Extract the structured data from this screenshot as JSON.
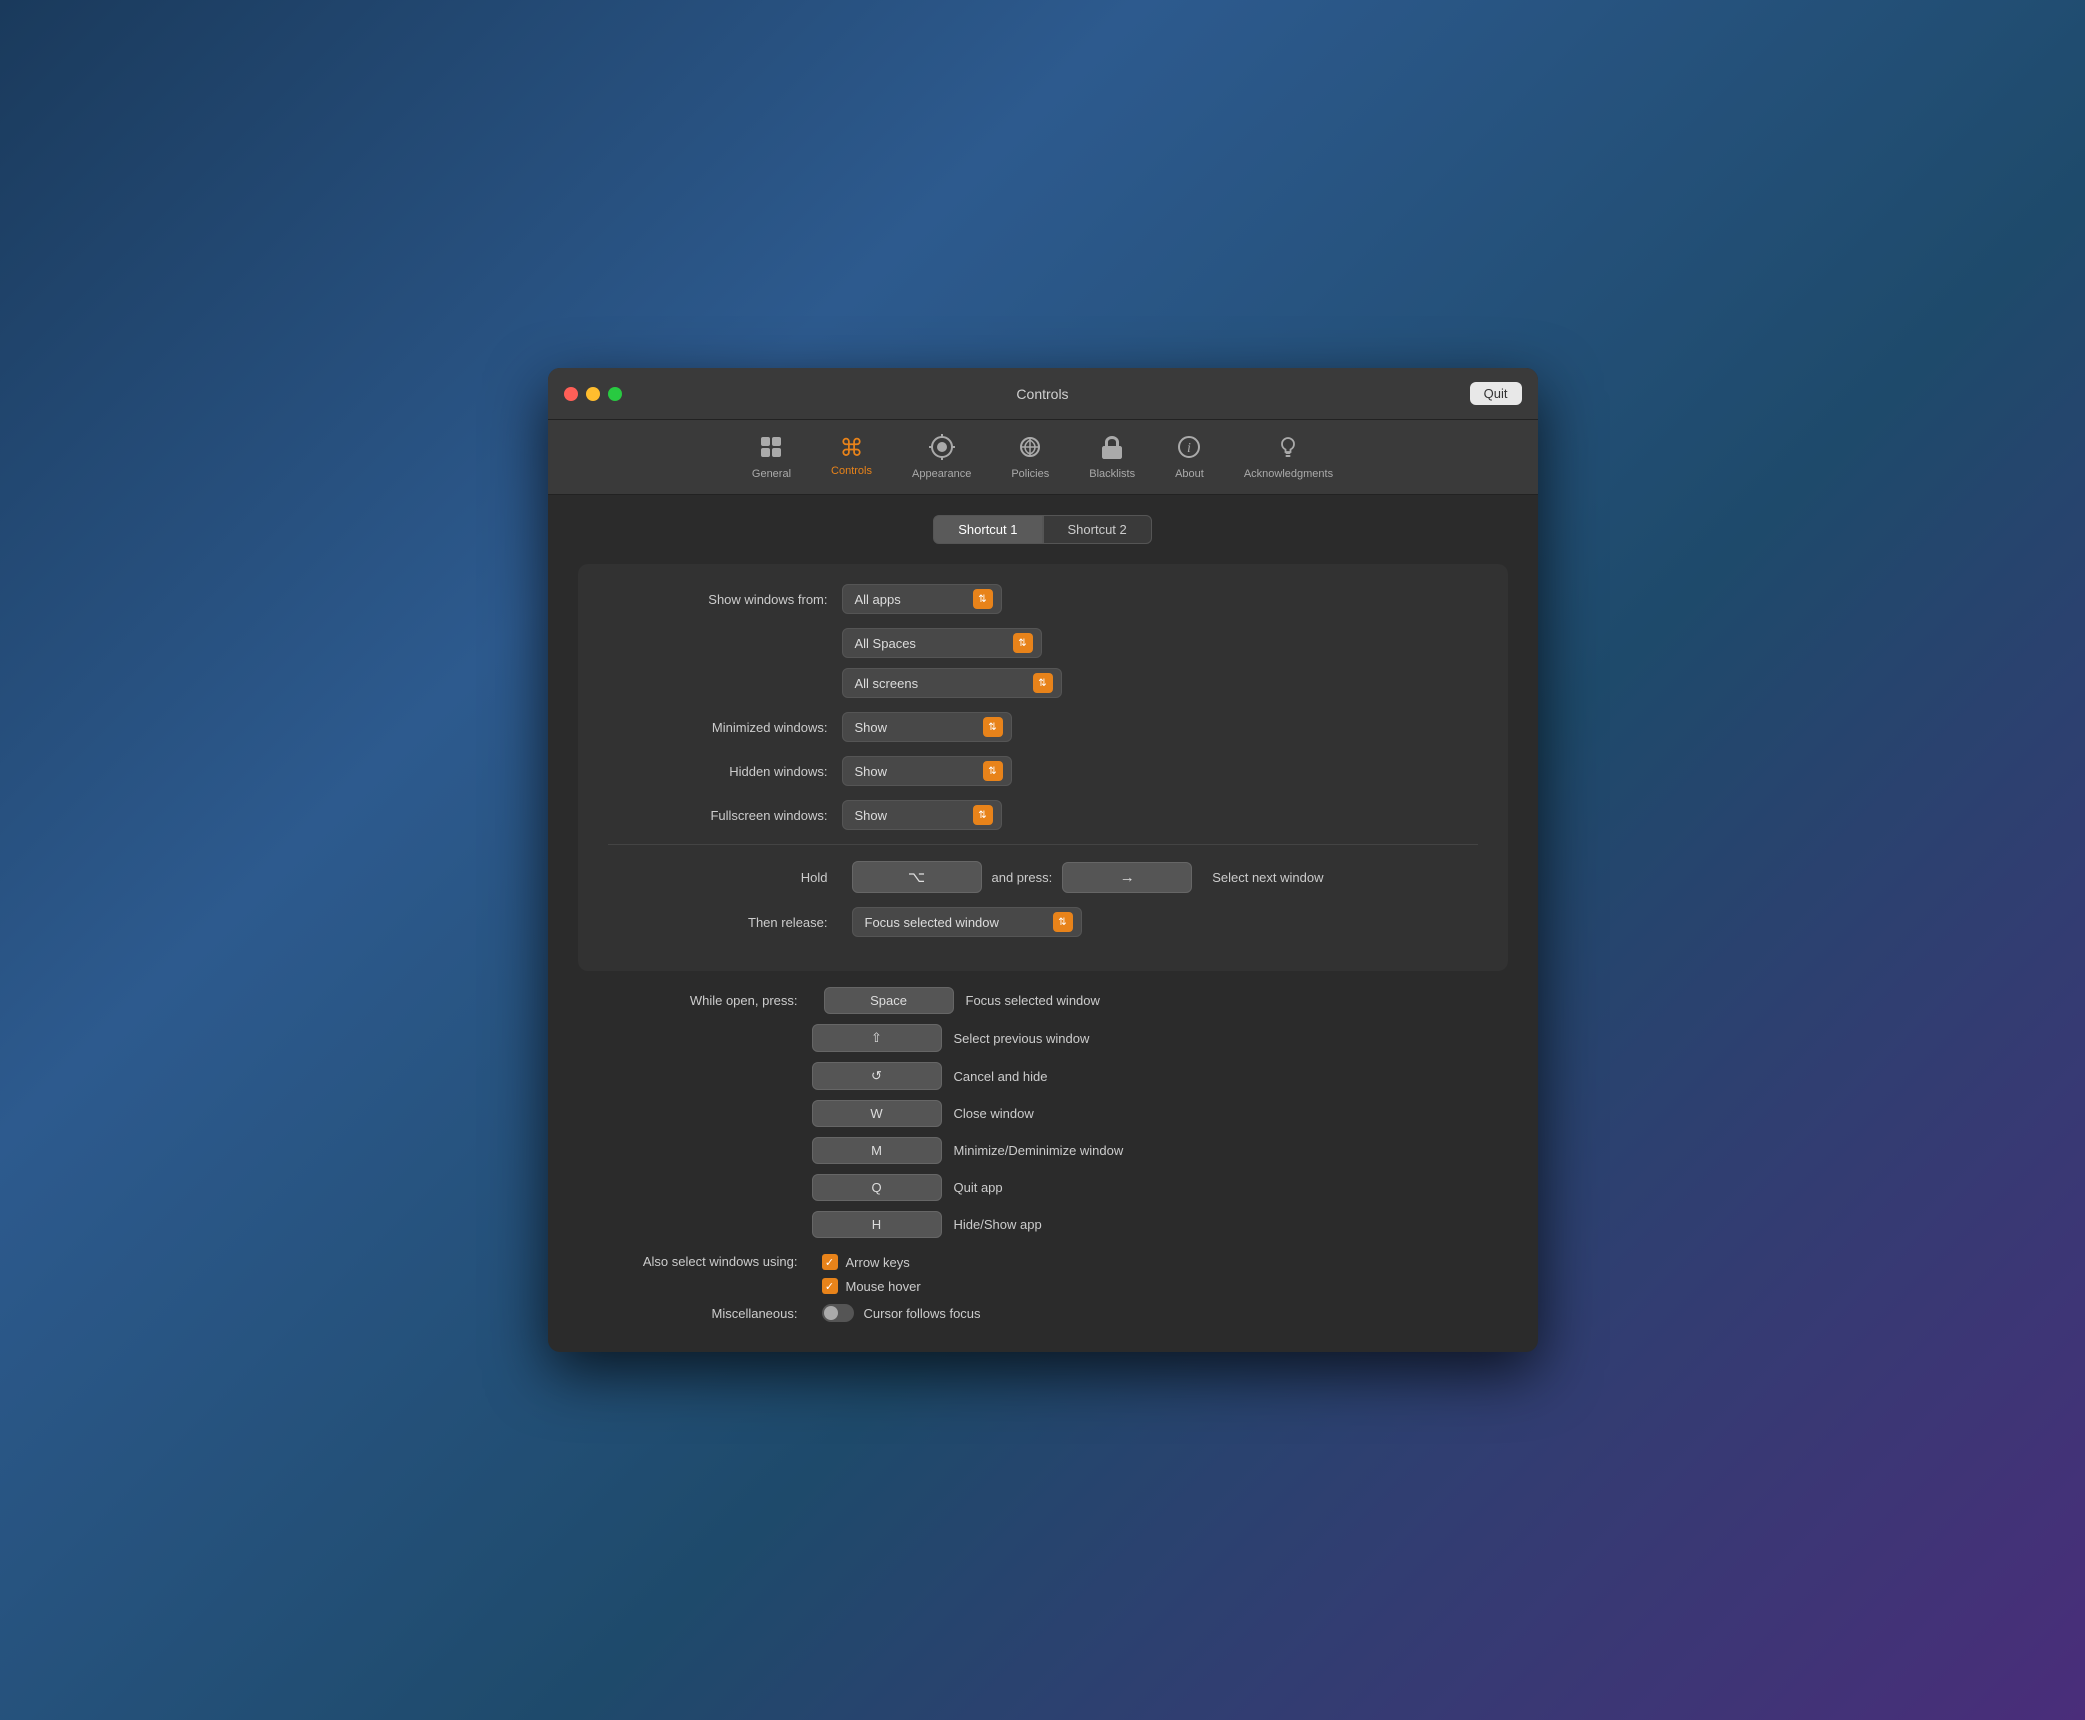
{
  "window": {
    "title": "Controls",
    "quit_label": "Quit"
  },
  "toolbar": {
    "items": [
      {
        "id": "general",
        "label": "General",
        "icon": "⊟",
        "active": false
      },
      {
        "id": "controls",
        "label": "Controls",
        "icon": "⌘",
        "active": true
      },
      {
        "id": "appearance",
        "label": "Appearance",
        "icon": "🎨",
        "active": false
      },
      {
        "id": "policies",
        "label": "Policies",
        "icon": "📡",
        "active": false
      },
      {
        "id": "blacklists",
        "label": "Blacklists",
        "icon": "✋",
        "active": false
      },
      {
        "id": "about",
        "label": "About",
        "icon": "ℹ",
        "active": false
      },
      {
        "id": "acknowledgments",
        "label": "Acknowledgments",
        "icon": "👍",
        "active": false
      }
    ]
  },
  "tabs": [
    {
      "id": "shortcut1",
      "label": "Shortcut 1",
      "active": true
    },
    {
      "id": "shortcut2",
      "label": "Shortcut 2",
      "active": false
    }
  ],
  "show_windows": {
    "label": "Show windows from:",
    "value": "All apps",
    "spaces_value": "All Spaces",
    "screens_value": "All screens"
  },
  "minimized_windows": {
    "label": "Minimized windows:",
    "value": "Show"
  },
  "hidden_windows": {
    "label": "Hidden windows:",
    "value": "Show"
  },
  "fullscreen_windows": {
    "label": "Fullscreen windows:",
    "value": "Show"
  },
  "hold": {
    "label": "Hold",
    "key": "⌥",
    "and_press": "and press:",
    "press_key": "→",
    "action": "Select next window"
  },
  "then_release": {
    "label": "Then release:",
    "value": "Focus selected window"
  },
  "while_open": {
    "label": "While open, press:",
    "shortcuts": [
      {
        "key": "Space",
        "action": "Focus selected window"
      },
      {
        "key": "⇧",
        "action": "Select previous window"
      },
      {
        "key": "↺",
        "action": "Cancel and hide"
      },
      {
        "key": "W",
        "action": "Close window"
      },
      {
        "key": "M",
        "action": "Minimize/Deminimize window"
      },
      {
        "key": "Q",
        "action": "Quit app"
      },
      {
        "key": "H",
        "action": "Hide/Show app"
      }
    ]
  },
  "also_select": {
    "label": "Also select windows using:",
    "arrow_keys": "Arrow keys",
    "mouse_hover": "Mouse hover",
    "arrow_checked": true,
    "mouse_checked": true
  },
  "miscellaneous": {
    "label": "Miscellaneous:",
    "cursor_follows": "Cursor follows focus",
    "cursor_checked": false
  }
}
